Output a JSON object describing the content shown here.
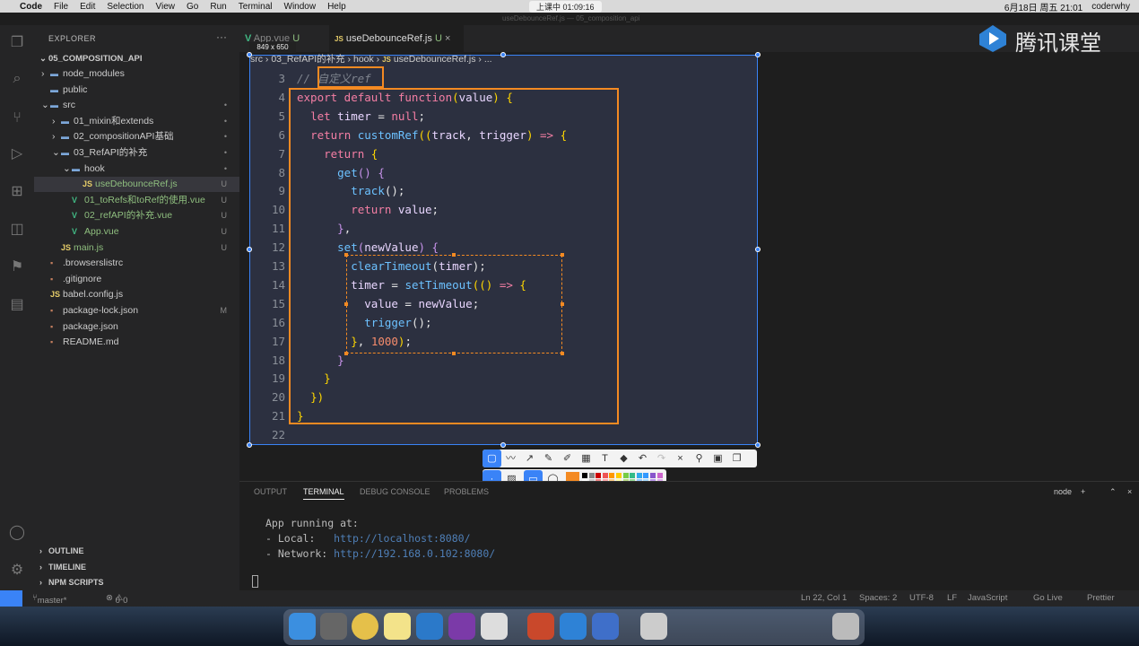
{
  "menubar": {
    "app": "Code",
    "items": [
      "File",
      "Edit",
      "Selection",
      "View",
      "Go",
      "Run",
      "Terminal",
      "Window",
      "Help"
    ],
    "center": "上课中 01:09:16",
    "date": "6月18日 周五 21:01",
    "user": "coderwhy"
  },
  "window_title": "useDebounceRef.js — 05_composition_api",
  "watermark": "腾讯课堂",
  "sidebar": {
    "title": "EXPLORER",
    "root": "05_COMPOSITION_API",
    "items": [
      {
        "label": "node_modules",
        "kind": "folder",
        "badge": ""
      },
      {
        "label": "public",
        "kind": "folder",
        "badge": ""
      },
      {
        "label": "src",
        "kind": "folder",
        "badge": "•"
      },
      {
        "label": "01_mixin和extends",
        "kind": "folder",
        "badge": "•"
      },
      {
        "label": "02_compositionAPI基础",
        "kind": "folder",
        "badge": "•"
      },
      {
        "label": "03_RefAPI的补充",
        "kind": "folder",
        "badge": "•"
      },
      {
        "label": "hook",
        "kind": "folder",
        "badge": "•"
      },
      {
        "label": "useDebounceRef.js",
        "kind": "js",
        "badge": "U"
      },
      {
        "label": "01_toRefs和toRef的使用.vue",
        "kind": "vue",
        "badge": "U"
      },
      {
        "label": "02_refAPI的补充.vue",
        "kind": "vue",
        "badge": "U"
      },
      {
        "label": "App.vue",
        "kind": "vue",
        "badge": "U"
      },
      {
        "label": "main.js",
        "kind": "js",
        "badge": "U"
      },
      {
        "label": ".browserslistrc",
        "kind": "file",
        "badge": ""
      },
      {
        "label": ".gitignore",
        "kind": "file",
        "badge": ""
      },
      {
        "label": "babel.config.js",
        "kind": "js",
        "badge": ""
      },
      {
        "label": "package-lock.json",
        "kind": "file",
        "badge": "M"
      },
      {
        "label": "package.json",
        "kind": "file",
        "badge": ""
      },
      {
        "label": "README.md",
        "kind": "file",
        "badge": ""
      }
    ],
    "sections": [
      "OUTLINE",
      "TIMELINE",
      "NPM SCRIPTS"
    ]
  },
  "tabs": [
    {
      "label": "App.vue",
      "badge": "U"
    },
    {
      "label": "useDebounceRef.js",
      "badge": "U"
    }
  ],
  "size_badge": "849 x 650",
  "breadcrumb": [
    "src",
    "03_RefAPI的补充",
    "hook",
    "useDebounceRef.js",
    "..."
  ],
  "code_lines": [
    {
      "n": "3",
      "tokens": [
        [
          "cm",
          "// "
        ],
        [
          "cm",
          "自定义ref"
        ]
      ]
    },
    {
      "n": "4",
      "tokens": [
        [
          "kw",
          "export default function"
        ],
        [
          "br",
          "("
        ],
        [
          "id",
          "value"
        ],
        [
          "br",
          ")"
        ],
        [
          "pl",
          " "
        ],
        [
          "br",
          "{"
        ]
      ]
    },
    {
      "n": "5",
      "tokens": [
        [
          "pl",
          "  "
        ],
        [
          "kw",
          "let"
        ],
        [
          "pl",
          " "
        ],
        [
          "id",
          "timer"
        ],
        [
          "pl",
          " = "
        ],
        [
          "kw",
          "null"
        ],
        [
          "pl",
          ";"
        ]
      ]
    },
    {
      "n": "6",
      "tokens": [
        [
          "pl",
          "  "
        ],
        [
          "kw",
          "return"
        ],
        [
          "pl",
          " "
        ],
        [
          "fn",
          "customRef"
        ],
        [
          "br",
          "(("
        ],
        [
          "id",
          "track"
        ],
        [
          "pl",
          ", "
        ],
        [
          "id",
          "trigger"
        ],
        [
          "br",
          ")"
        ],
        [
          "pl",
          " "
        ],
        [
          "kw",
          "=>"
        ],
        [
          "pl",
          " "
        ],
        [
          "br",
          "{"
        ]
      ]
    },
    {
      "n": "7",
      "tokens": [
        [
          "pl",
          "    "
        ],
        [
          "kw",
          "return"
        ],
        [
          "pl",
          " "
        ],
        [
          "br",
          "{"
        ]
      ]
    },
    {
      "n": "8",
      "tokens": [
        [
          "pl",
          "      "
        ],
        [
          "fn",
          "get"
        ],
        [
          "pr",
          "()"
        ],
        [
          "pl",
          " "
        ],
        [
          "pr",
          "{"
        ]
      ]
    },
    {
      "n": "9",
      "tokens": [
        [
          "pl",
          "        "
        ],
        [
          "fn",
          "track"
        ],
        [
          "pl",
          "();"
        ]
      ]
    },
    {
      "n": "10",
      "tokens": [
        [
          "pl",
          "        "
        ],
        [
          "kw",
          "return"
        ],
        [
          "pl",
          " "
        ],
        [
          "id",
          "value"
        ],
        [
          "pl",
          ";"
        ]
      ]
    },
    {
      "n": "11",
      "tokens": [
        [
          "pl",
          "      "
        ],
        [
          "pr",
          "}"
        ],
        [
          "pl",
          ","
        ]
      ]
    },
    {
      "n": "12",
      "tokens": [
        [
          "pl",
          "      "
        ],
        [
          "fn",
          "set"
        ],
        [
          "pr",
          "("
        ],
        [
          "id",
          "newValue"
        ],
        [
          "pr",
          ")"
        ],
        [
          "pl",
          " "
        ],
        [
          "pr",
          "{"
        ]
      ]
    },
    {
      "n": "13",
      "tokens": [
        [
          "pl",
          "        "
        ],
        [
          "fn",
          "clearTimeout"
        ],
        [
          "pl",
          "("
        ],
        [
          "id",
          "timer"
        ],
        [
          "pl",
          ");"
        ]
      ]
    },
    {
      "n": "14",
      "tokens": [
        [
          "pl",
          "        "
        ],
        [
          "id",
          "timer"
        ],
        [
          "pl",
          " = "
        ],
        [
          "fn",
          "setTimeout"
        ],
        [
          "br",
          "(()"
        ],
        [
          "pl",
          " "
        ],
        [
          "kw",
          "=>"
        ],
        [
          "pl",
          " "
        ],
        [
          "br",
          "{"
        ]
      ]
    },
    {
      "n": "15",
      "tokens": [
        [
          "pl",
          "          "
        ],
        [
          "id",
          "value"
        ],
        [
          "pl",
          " = "
        ],
        [
          "id",
          "newValue"
        ],
        [
          "pl",
          ";"
        ]
      ]
    },
    {
      "n": "16",
      "tokens": [
        [
          "pl",
          "          "
        ],
        [
          "fn",
          "trigger"
        ],
        [
          "pl",
          "();"
        ]
      ]
    },
    {
      "n": "17",
      "tokens": [
        [
          "pl",
          "        "
        ],
        [
          "br",
          "}"
        ],
        [
          "pl",
          ", "
        ],
        [
          "nm",
          "1000"
        ],
        [
          "br",
          ")"
        ],
        [
          "pl",
          ";"
        ]
      ]
    },
    {
      "n": "18",
      "tokens": [
        [
          "pl",
          "      "
        ],
        [
          "pr",
          "}"
        ]
      ]
    },
    {
      "n": "19",
      "tokens": [
        [
          "pl",
          "    "
        ],
        [
          "br",
          "}"
        ]
      ]
    },
    {
      "n": "20",
      "tokens": [
        [
          "pl",
          "  "
        ],
        [
          "br",
          "})"
        ]
      ]
    },
    {
      "n": "21",
      "tokens": [
        [
          "br",
          "}"
        ]
      ]
    },
    {
      "n": "22",
      "tokens": []
    }
  ],
  "panel": {
    "tabs": [
      "OUTPUT",
      "TERMINAL",
      "DEBUG CONSOLE",
      "PROBLEMS"
    ],
    "terminal_label": "node",
    "lines": [
      {
        "text": "App running at:",
        "url": ""
      },
      {
        "text": "- Local:   ",
        "url": "http://localhost:8080/"
      },
      {
        "text": "- Network: ",
        "url": "http://192.168.0.102:8080/"
      }
    ]
  },
  "statusbar": {
    "branch": "master*",
    "errors": "0",
    "warnings": "0",
    "position": "Ln 22, Col 1",
    "spaces": "Spaces: 2",
    "encoding": "UTF-8",
    "eol": "LF",
    "language": "JavaScript",
    "golive": "Go Live",
    "prettier": "Prettier"
  },
  "colors": {
    "accent": "#3a83f7",
    "annotation": "#f48a22"
  },
  "icons": [
    "files-icon",
    "search-icon",
    "source-control-icon",
    "run-debug-icon",
    "extensions-icon",
    "remote-icon",
    "bookmark-icon",
    "docker-icon",
    "account-icon",
    "settings-gear-icon"
  ]
}
